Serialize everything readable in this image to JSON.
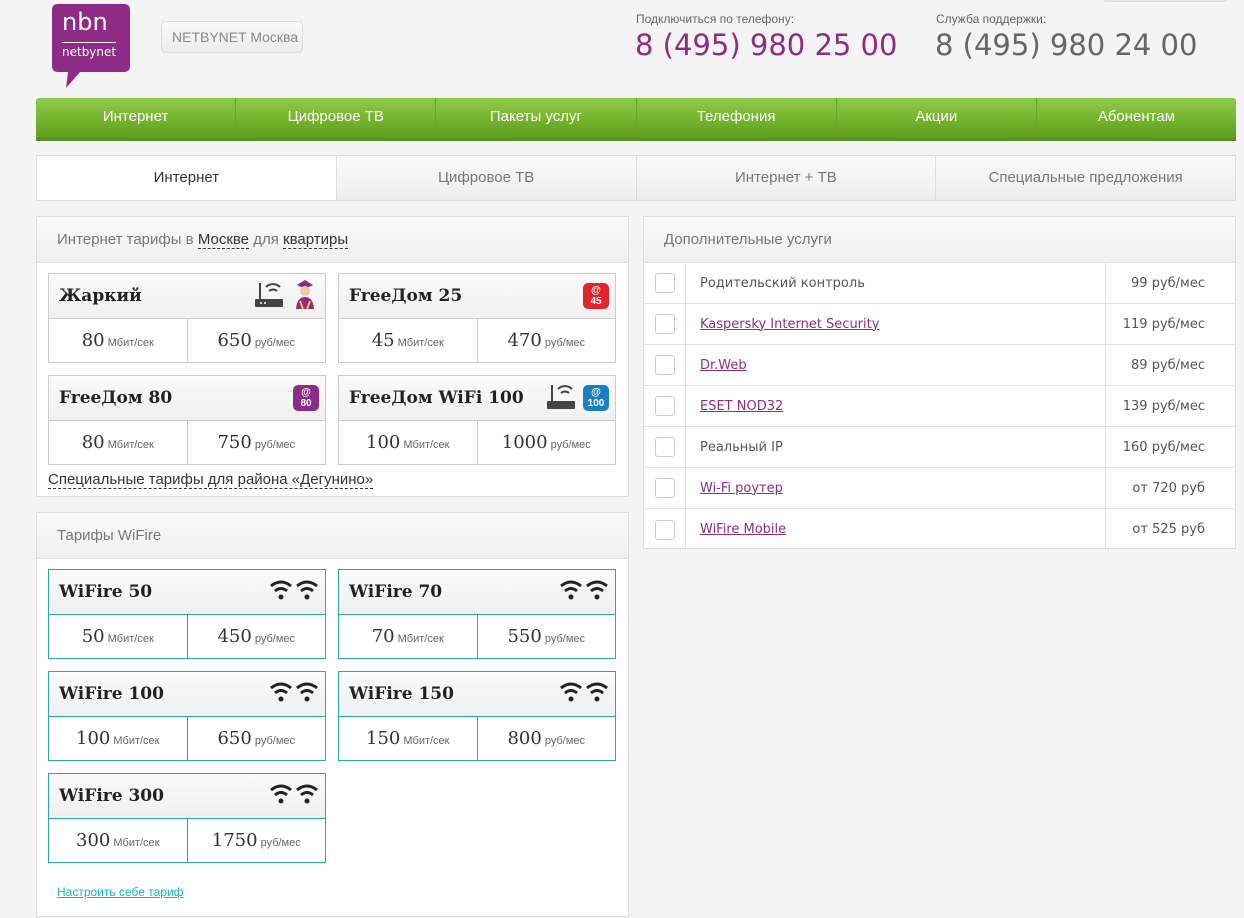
{
  "header": {
    "logo_top": "nbn",
    "logo_bottom": "netbynet",
    "region_button": "NETBYNET Москва",
    "sales": {
      "caption": "Подключиться по телефону:",
      "number": "8 (495) 980 25 00"
    },
    "support": {
      "caption": "Служба поддержки:",
      "number": "8 (495) 980 24 00"
    }
  },
  "main_nav": [
    "Интернет",
    "Цифровое ТВ",
    "Пакеты услуг",
    "Телефония",
    "Акции",
    "Абонентам"
  ],
  "sub_tabs": {
    "items": [
      "Интернет",
      "Цифровое ТВ",
      "Интернет + ТВ",
      "Специальные предложения"
    ],
    "active": 0
  },
  "internet_panel": {
    "title_prefix": "Интернет тарифы в",
    "city": "Москве",
    "title_mid": "для",
    "housing": "квартиры",
    "special_link": "Специальные тарифы для района «Дегунино»",
    "cards": [
      {
        "name": "Жаркий",
        "speed": "80",
        "speed_unit": "Мбит/сек",
        "price": "650",
        "price_unit": "руб/мес"
      },
      {
        "name": "FreeДом 25",
        "speed": "45",
        "speed_unit": "Мбит/сек",
        "price": "470",
        "price_unit": "руб/мес",
        "badge": "45"
      },
      {
        "name": "FreeДом 80",
        "speed": "80",
        "speed_unit": "Мбит/сек",
        "price": "750",
        "price_unit": "руб/мес",
        "badge": "80"
      },
      {
        "name": "FreeДом WiFi 100",
        "speed": "100",
        "speed_unit": "Мбит/сек",
        "price": "1000",
        "price_unit": "руб/мес",
        "badge": "100"
      }
    ]
  },
  "wifire_panel": {
    "title": "Тарифы WiFire",
    "custom_link": "Настроить себе тариф",
    "cards": [
      {
        "name": "WiFire 50",
        "speed": "50",
        "speed_unit": "Мбит/сек",
        "price": "450",
        "price_unit": "руб/мес"
      },
      {
        "name": "WiFire 70",
        "speed": "70",
        "speed_unit": "Мбит/сек",
        "price": "550",
        "price_unit": "руб/мес"
      },
      {
        "name": "WiFire 100",
        "speed": "100",
        "speed_unit": "Мбит/сек",
        "price": "650",
        "price_unit": "руб/мес"
      },
      {
        "name": "WiFire 150",
        "speed": "150",
        "speed_unit": "Мбит/сек",
        "price": "800",
        "price_unit": "руб/мес"
      },
      {
        "name": "WiFire 300",
        "speed": "300",
        "speed_unit": "Мбит/сек",
        "price": "1750",
        "price_unit": "руб/мес"
      }
    ]
  },
  "services_panel": {
    "title": "Дополнительные услуги",
    "items": [
      {
        "name": "Родительский контроль",
        "price": "99 руб/мес",
        "link": false
      },
      {
        "name": "Kaspersky Internet Security",
        "price": "119 руб/мес",
        "link": true
      },
      {
        "name": "Dr.Web",
        "price": "89 руб/мес",
        "link": true
      },
      {
        "name": "ESET NOD32",
        "price": "139 руб/мес",
        "link": true
      },
      {
        "name": "Реальный IP",
        "price": "160 руб/мес",
        "link": false
      },
      {
        "name": "Wi-Fi роутер",
        "price": "от 720 руб",
        "link": true
      },
      {
        "name": "WiFire Mobile",
        "price": "от 525 руб",
        "link": true
      }
    ]
  },
  "colors": {
    "brand": "#8e2b86",
    "nav_green": "#74b32c",
    "wifire_teal": "#2aa8a8",
    "link_teal": "#1ab0c0"
  }
}
